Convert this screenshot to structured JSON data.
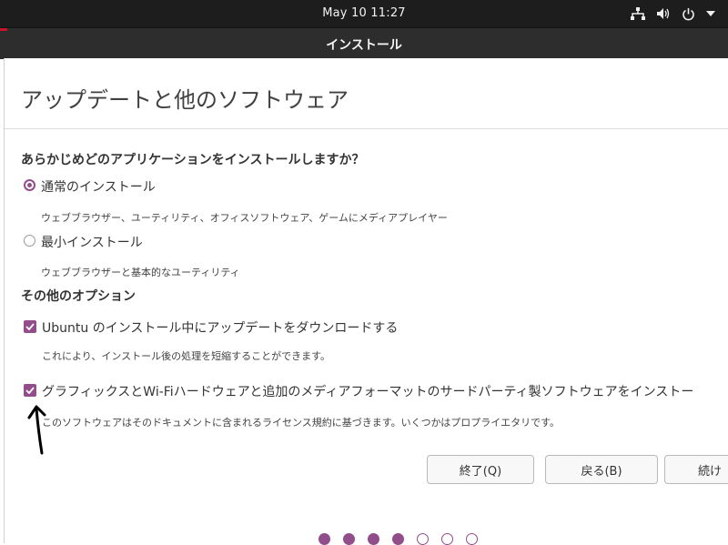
{
  "topbar": {
    "clock": "May 10  11:27"
  },
  "tray": {
    "icons": [
      "network-icon",
      "volume-icon",
      "power-icon",
      "chevron-down-icon"
    ]
  },
  "window": {
    "title": "インストール"
  },
  "page": {
    "title": "アップデートと他のソフトウェア"
  },
  "question": "あらかじめどのアプリケーションをインストールしますか？",
  "install_type": {
    "normal": {
      "label": "通常のインストール",
      "description": "ウェブブラウザー、ユーティリティ、オフィスソフトウェア、ゲームにメディアプレイヤー",
      "selected": true
    },
    "minimal": {
      "label": "最小インストール",
      "description": "ウェブブラウザーと基本的なユーティリティ",
      "selected": false
    }
  },
  "other_options": {
    "heading": "その他のオプション",
    "download_updates": {
      "label": "Ubuntu のインストール中にアップデートをダウンロードする",
      "description": "これにより、インストール後の処理を短縮することができます。",
      "checked": true
    },
    "third_party": {
      "label": "グラフィックスとWi-Fiハードウェアと追加のメディアフォーマットのサードパーティ製ソフトウェアをインストー",
      "description": "このソフトウェアはそのドキュメントに含まれるライセンス規約に基づきます。いくつかはプロプライエタリです。",
      "checked": true
    }
  },
  "buttons": {
    "quit": "終了(Q)",
    "back": "戻る(B)",
    "continue": "続け"
  },
  "progress": {
    "steps_total": 7,
    "steps_completed": 4
  },
  "colors": {
    "accent": "#924d8b",
    "topbar": "#1d1d1d",
    "titlebar": "#2d2d2d"
  }
}
